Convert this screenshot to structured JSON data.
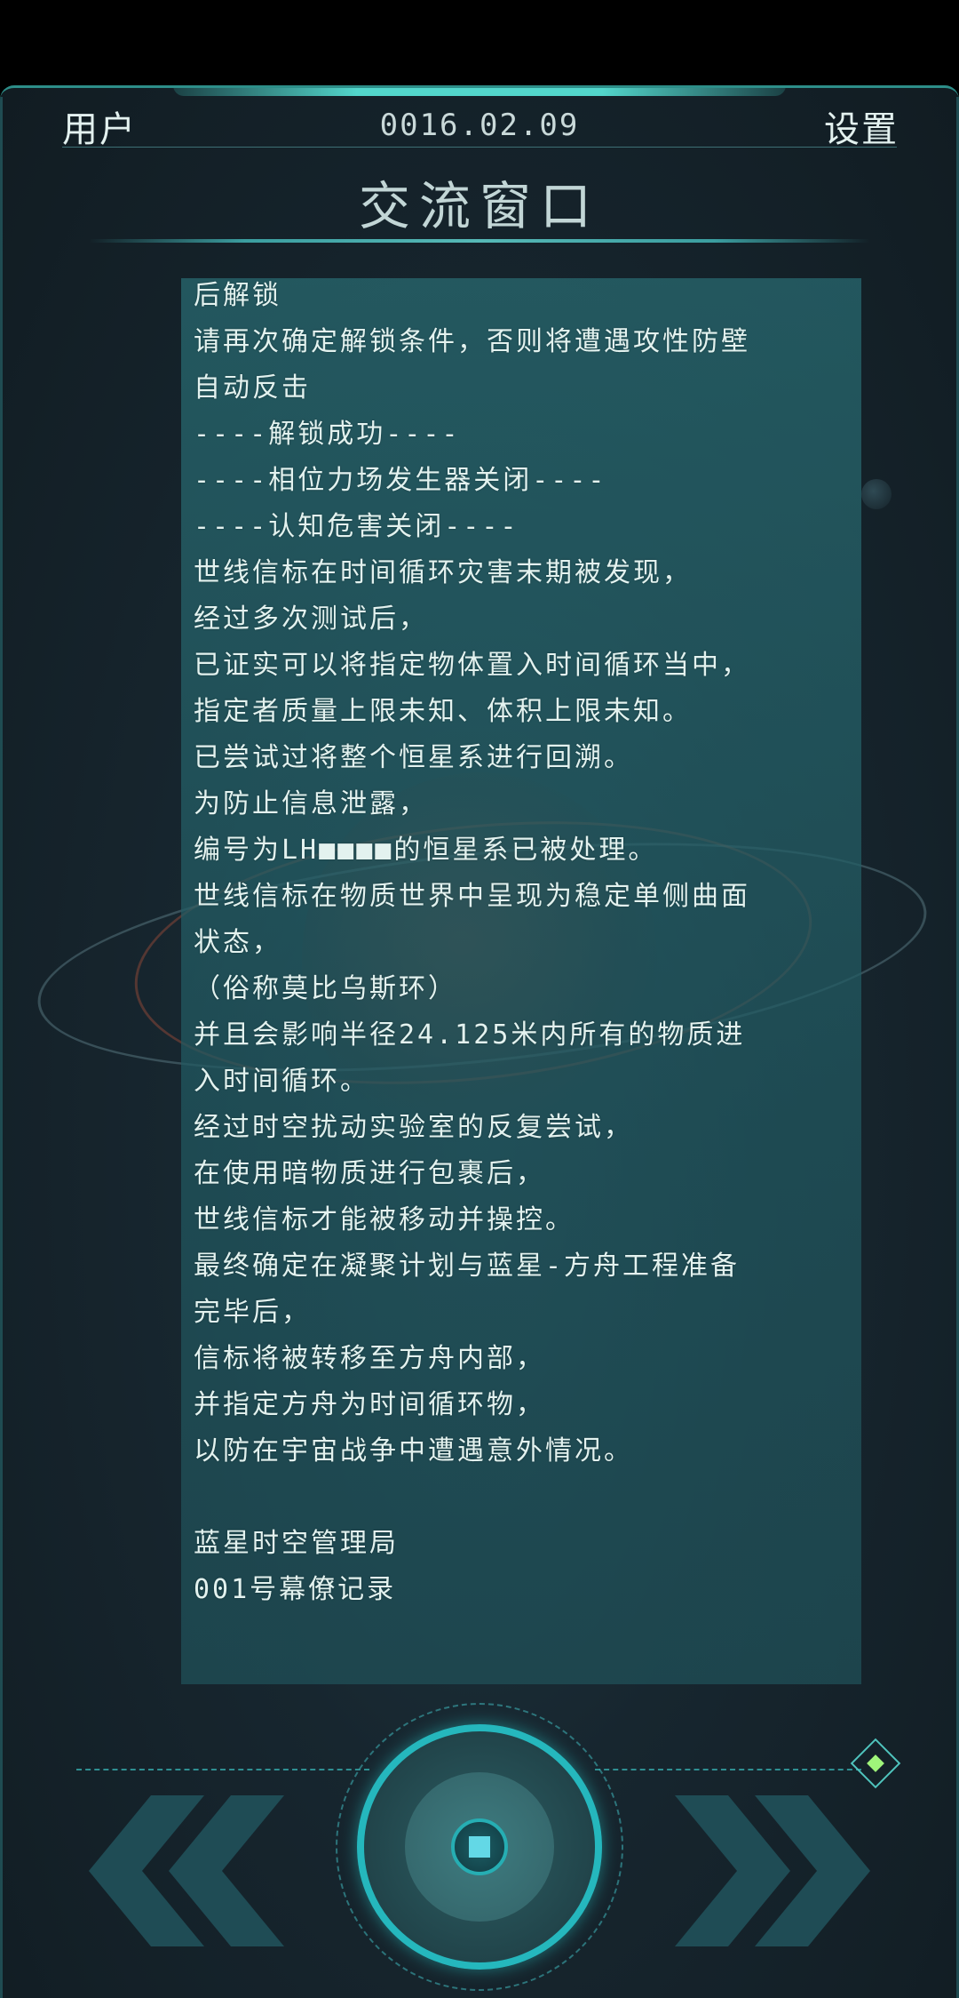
{
  "header": {
    "user_label": "用户",
    "date": "0016.02.09",
    "settings_label": "设置"
  },
  "window_title": "交流窗口",
  "message_lines": [
    "后解锁",
    "请再次确定解锁条件，否则将遭遇攻性防壁",
    "自动反击",
    "----解锁成功----",
    "----相位力场发生器关闭----",
    "----认知危害关闭----",
    "世线信标在时间循环灾害末期被发现，",
    "经过多次测试后，",
    "已证实可以将指定物体置入时间循环当中，",
    "指定者质量上限未知、体积上限未知。",
    "已尝试过将整个恒星系进行回溯。",
    "为防止信息泄露，",
    "编号为LH■■■■的恒星系已被处理。",
    "世线信标在物质世界中呈现为稳定单侧曲面",
    "状态，",
    "（俗称莫比乌斯环）",
    "并且会影响半径24.125米内所有的物质进",
    "入时间循环。",
    "经过时空扰动实验室的反复尝试，",
    "在使用暗物质进行包裹后，",
    "世线信标才能被移动并操控。",
    "最终确定在凝聚计划与蓝星-方舟工程准备",
    "完毕后，",
    "信标将被转移至方舟内部，",
    "并指定方舟为时间循环物，",
    "以防在宇宙战争中遭遇意外情况。",
    "",
    "蓝星时空管理局",
    " 001号幕僚记录"
  ],
  "controls": {
    "prev_icon": "double-chevron-left-icon",
    "next_icon": "double-chevron-right-icon",
    "home_icon": "circle-button-icon",
    "indicator_icon": "diamond-indicator-icon"
  },
  "colors": {
    "accent": "#25b7bd",
    "panel": "#286970",
    "text": "#e3f2ef",
    "indicator": "#9ff57a"
  }
}
